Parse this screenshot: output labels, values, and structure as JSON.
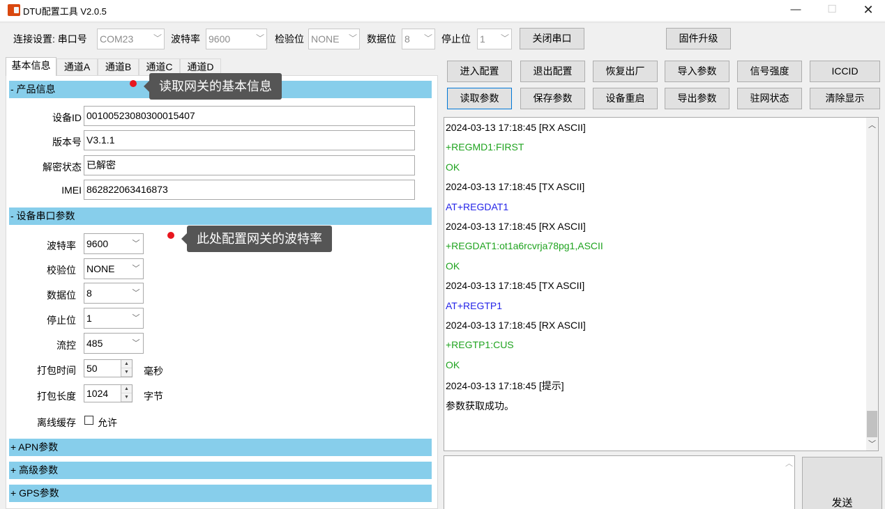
{
  "window": {
    "title": "DTU配置工具 V2.0.5",
    "min_glyph": "—",
    "max_glyph": "☐",
    "close_glyph": "✕"
  },
  "toolbar": {
    "conn_label": "连接设置: 串口号",
    "port_value": "COM23",
    "baud_label": "波特率",
    "baud_value": "9600",
    "parity_label": "检验位",
    "parity_value": "NONE",
    "databits_label": "数据位",
    "databits_value": "8",
    "stopbits_label": "停止位",
    "stopbits_value": "1",
    "close_port_label": "关闭串口",
    "firmware_label": "固件升级",
    "dropdown_glyph": "﹀"
  },
  "tabs": [
    "基本信息",
    "通道A",
    "通道B",
    "通道C",
    "通道D"
  ],
  "product": {
    "header": "- 产品信息",
    "device_id_label": "设备ID",
    "device_id": "00100523080300015407",
    "version_label": "版本号",
    "version": "V3.1.1",
    "decrypt_label": "解密状态",
    "decrypt": "已解密",
    "imei_label": "IMEI",
    "imei": "862822063416873"
  },
  "serial": {
    "header": "- 设备串口参数",
    "baud_label": "波特率",
    "baud": "9600",
    "parity_label": "校验位",
    "parity": "NONE",
    "databits_label": "数据位",
    "databits": "8",
    "stopbits_label": "停止位",
    "stopbits": "1",
    "flow_label": "流控",
    "flow": "485",
    "pack_time_label": "打包时间",
    "pack_time": "50",
    "pack_time_unit": "毫秒",
    "pack_len_label": "打包长度",
    "pack_len": "1024",
    "pack_len_unit": "字节",
    "offline_label": "离线缓存",
    "offline_allow": "允许"
  },
  "collapsed_sections": [
    "+ APN参数",
    "+ 高级参数",
    "+ GPS参数"
  ],
  "callouts": {
    "basic_info": "读取网关的基本信息",
    "baud_config": "此处配置网关的波特率"
  },
  "actions": {
    "row1": [
      "进入配置",
      "退出配置",
      "恢复出厂",
      "导入参数",
      "信号强度",
      "ICCID"
    ],
    "row2": [
      "读取参数",
      "保存参数",
      "设备重启",
      "导出参数",
      "驻网状态",
      "清除显示"
    ]
  },
  "log": [
    {
      "text": "2024-03-13 17:18:45 [RX ASCII]",
      "color": "#000000"
    },
    {
      "text": "+REGMD1:FIRST",
      "color": "#1fa31f"
    },
    {
      "text": "OK",
      "color": "#1fa31f"
    },
    {
      "text": "2024-03-13 17:18:45 [TX ASCII]",
      "color": "#000000"
    },
    {
      "text": "AT+REGDAT1",
      "color": "#2323e8"
    },
    {
      "text": "2024-03-13 17:18:45 [RX ASCII]",
      "color": "#000000"
    },
    {
      "text": "+REGDAT1:ot1a6rcvrja78pg1,ASCII",
      "color": "#1fa31f"
    },
    {
      "text": "OK",
      "color": "#1fa31f"
    },
    {
      "text": "2024-03-13 17:18:45 [TX ASCII]",
      "color": "#000000"
    },
    {
      "text": "AT+REGTP1",
      "color": "#2323e8"
    },
    {
      "text": "2024-03-13 17:18:45 [RX ASCII]",
      "color": "#000000"
    },
    {
      "text": "+REGTP1:CUS",
      "color": "#1fa31f"
    },
    {
      "text": "OK",
      "color": "#1fa31f"
    },
    {
      "text": "2024-03-13 17:18:45 [提示]",
      "color": "#000000"
    },
    {
      "text": "参数获取成功。",
      "color": "#000000"
    }
  ],
  "send": {
    "label": "发送"
  },
  "theme": {
    "section_color": "#87ceeb",
    "callout_dot": "#e8161e",
    "callout_bg": "#555555"
  }
}
